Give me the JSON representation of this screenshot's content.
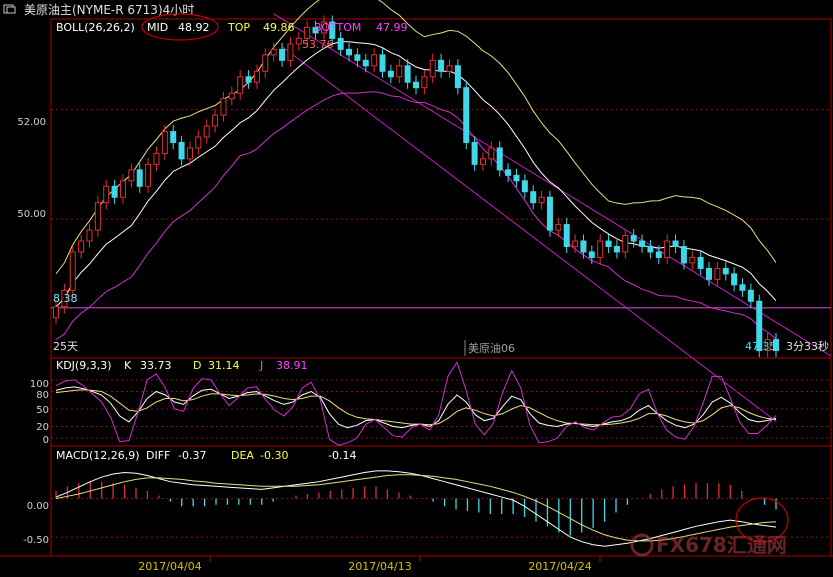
{
  "window": {
    "title": "美原油主(NYME-R 6713)4小时",
    "icon": "window-menu-icon"
  },
  "colors": {
    "background": "#000000",
    "frame": "#b00000",
    "grid_red": "#8a1010",
    "bull_candle": "#e03030",
    "bear_candle": "#40d8e8",
    "boll_mid": "#ffffff",
    "boll_top": "#e8e080",
    "boll_bottom": "#d030d0",
    "channel": "#c020c0",
    "k_line": "#ffffff",
    "d_line": "#e8e080",
    "j_line": "#d030d0",
    "label_white": "#ffffff",
    "label_yellow": "#ffff40",
    "label_magenta": "#ff40ff",
    "annotation": "#c00000",
    "date_label": "#d8c000",
    "price_axis_label": "#ff6060"
  },
  "chart_data": [
    {
      "type": "candlestick",
      "panel": "price",
      "indicator": {
        "name": "BOLL(26,26,2)",
        "mid_label": "MID",
        "mid": "48.92",
        "top_label": "TOP",
        "top": "49.86",
        "bottom_label": "BOTTOM",
        "bottom": "47.99"
      },
      "y_ticks": [
        "52.00",
        "50.00"
      ],
      "ylim": [
        47.5,
        53.6
      ],
      "horizontal_line": {
        "value": 48.38,
        "label": "8.38"
      },
      "annotations": {
        "high": "53.76",
        "last_price": "47.35",
        "countdown": "3分33秒",
        "period_label": "25天",
        "instrument": "美原油06"
      },
      "x_dates": [
        "2017/04/04",
        "2017/04/13",
        "2017/04/24"
      ],
      "ohlc_close": [
        48.4,
        48.7,
        49.4,
        49.6,
        49.8,
        50.3,
        50.6,
        50.4,
        50.7,
        50.9,
        50.6,
        51.0,
        51.2,
        51.6,
        51.4,
        51.1,
        51.3,
        51.5,
        51.7,
        51.9,
        52.2,
        52.3,
        52.6,
        52.5,
        52.7,
        53.0,
        53.1,
        52.9,
        53.2,
        53.3,
        53.5,
        53.4,
        53.6,
        53.3,
        53.1,
        53.0,
        52.9,
        52.8,
        53.0,
        52.7,
        52.6,
        52.8,
        52.5,
        52.4,
        52.6,
        52.9,
        52.7,
        52.8,
        52.4,
        51.4,
        51.0,
        51.1,
        51.3,
        50.9,
        50.8,
        50.7,
        50.5,
        50.3,
        50.4,
        49.8,
        49.9,
        49.5,
        49.6,
        49.4,
        49.3,
        49.6,
        49.5,
        49.4,
        49.7,
        49.6,
        49.5,
        49.4,
        49.3,
        49.6,
        49.5,
        49.2,
        49.3,
        49.1,
        48.9,
        49.1,
        49.0,
        48.8,
        48.7,
        48.5,
        47.6,
        47.8,
        47.6
      ]
    },
    {
      "type": "line",
      "panel": "kdj",
      "indicator": {
        "name": "KDJ(9,3,3)",
        "k_label": "K",
        "k": "33.73",
        "d_label": "D",
        "d": "31.14",
        "j_label": "J",
        "j": "38.91"
      },
      "y_ticks": [
        "100",
        "80",
        "50",
        "20",
        "0"
      ],
      "ylim": [
        -10,
        110
      ],
      "series": [
        {
          "name": "K",
          "values": [
            82,
            86,
            88,
            85,
            80,
            74,
            60,
            38,
            28,
            45,
            68,
            80,
            74,
            62,
            58,
            72,
            82,
            84,
            76,
            68,
            72,
            78,
            80,
            72,
            64,
            58,
            62,
            74,
            80,
            70,
            42,
            24,
            18,
            22,
            30,
            32,
            26,
            20,
            18,
            22,
            24,
            20,
            30,
            58,
            74,
            62,
            40,
            30,
            34,
            54,
            72,
            66,
            42,
            26,
            22,
            20,
            24,
            26,
            22,
            20,
            24,
            28,
            30,
            36,
            48,
            56,
            42,
            30,
            22,
            18,
            24,
            40,
            62,
            70,
            60,
            44,
            32,
            28,
            30,
            34
          ]
        },
        {
          "name": "D",
          "values": [
            78,
            80,
            82,
            83,
            82,
            80,
            72,
            60,
            48,
            46,
            52,
            62,
            68,
            68,
            64,
            66,
            72,
            76,
            76,
            74,
            73,
            74,
            76,
            75,
            72,
            68,
            66,
            68,
            72,
            72,
            64,
            52,
            42,
            36,
            33,
            32,
            30,
            28,
            26,
            24,
            24,
            23,
            25,
            34,
            46,
            52,
            48,
            42,
            38,
            42,
            50,
            56,
            52,
            44,
            36,
            30,
            26,
            25,
            24,
            23,
            23,
            24,
            26,
            29,
            34,
            42,
            42,
            38,
            32,
            28,
            26,
            30,
            40,
            52,
            56,
            52,
            44,
            38,
            34,
            32
          ]
        },
        {
          "name": "J",
          "values": [
            90,
            98,
            100,
            90,
            76,
            62,
            36,
            -6,
            -4,
            44,
            100,
            110,
            86,
            50,
            46,
            84,
            102,
            100,
            76,
            56,
            70,
            86,
            88,
            66,
            48,
            38,
            54,
            86,
            96,
            66,
            -2,
            -12,
            -8,
            0,
            24,
            32,
            18,
            4,
            2,
            18,
            24,
            14,
            40,
            106,
            130,
            82,
            24,
            6,
            26,
            78,
            116,
            86,
            22,
            -8,
            -6,
            0,
            20,
            28,
            18,
            14,
            26,
            36,
            38,
            50,
            76,
            84,
            42,
            14,
            2,
            -2,
            20,
            60,
            106,
            106,
            68,
            28,
            8,
            8,
            22,
            39
          ]
        }
      ]
    },
    {
      "type": "bar+line",
      "panel": "macd",
      "indicator": {
        "name": "MACD(12,26,9)",
        "diff_label": "DIFF",
        "diff": "-0.37",
        "dea_label": "DEA",
        "dea": "-0.30",
        "macd": "-0.14"
      },
      "y_ticks": [
        "0.00",
        "-0.50"
      ],
      "ylim": [
        -0.72,
        0.45
      ],
      "series": [
        {
          "name": "DIFF",
          "values": [
            0.02,
            0.08,
            0.15,
            0.22,
            0.28,
            0.32,
            0.34,
            0.33,
            0.3,
            0.26,
            0.22,
            0.2,
            0.18,
            0.17,
            0.16,
            0.15,
            0.14,
            0.13,
            0.12,
            0.14,
            0.16,
            0.18,
            0.2,
            0.22,
            0.25,
            0.28,
            0.31,
            0.34,
            0.36,
            0.36,
            0.35,
            0.33,
            0.3,
            0.26,
            0.22,
            0.18,
            0.14,
            0.1,
            0.06,
            0.02,
            -0.02,
            -0.1,
            -0.2,
            -0.3,
            -0.4,
            -0.5,
            -0.56,
            -0.6,
            -0.62,
            -0.6,
            -0.58,
            -0.55,
            -0.52,
            -0.48,
            -0.44,
            -0.4,
            -0.36,
            -0.33,
            -0.3,
            -0.28,
            -0.3,
            -0.33,
            -0.35,
            -0.37
          ]
        },
        {
          "name": "DEA",
          "values": [
            0.0,
            0.03,
            0.06,
            0.1,
            0.14,
            0.18,
            0.22,
            0.25,
            0.27,
            0.27,
            0.26,
            0.25,
            0.23,
            0.22,
            0.2,
            0.19,
            0.18,
            0.17,
            0.16,
            0.16,
            0.16,
            0.16,
            0.17,
            0.18,
            0.2,
            0.22,
            0.24,
            0.26,
            0.28,
            0.3,
            0.31,
            0.31,
            0.3,
            0.29,
            0.27,
            0.25,
            0.22,
            0.19,
            0.16,
            0.12,
            0.08,
            0.03,
            -0.03,
            -0.1,
            -0.18,
            -0.26,
            -0.34,
            -0.41,
            -0.47,
            -0.51,
            -0.54,
            -0.55,
            -0.55,
            -0.54,
            -0.52,
            -0.49,
            -0.46,
            -0.43,
            -0.4,
            -0.37,
            -0.35,
            -0.33,
            -0.31,
            -0.3
          ]
        },
        {
          "name": "MACD",
          "values": [
            0.1,
            0.16,
            0.2,
            0.22,
            0.22,
            0.2,
            0.18,
            0.14,
            0.1,
            0.04,
            -0.04,
            -0.1,
            -0.1,
            -0.1,
            -0.08,
            -0.08,
            -0.08,
            -0.08,
            -0.08,
            -0.04,
            0.0,
            0.04,
            0.06,
            0.08,
            0.1,
            0.12,
            0.14,
            0.16,
            0.16,
            0.12,
            0.08,
            0.04,
            0.0,
            -0.04,
            -0.1,
            -0.14,
            -0.16,
            -0.18,
            -0.2,
            -0.2,
            -0.2,
            -0.24,
            -0.3,
            -0.36,
            -0.44,
            -0.48,
            -0.44,
            -0.38,
            -0.3,
            -0.18,
            -0.08,
            0.0,
            0.06,
            0.12,
            0.16,
            0.18,
            0.2,
            0.2,
            0.2,
            0.18,
            0.1,
            0.0,
            -0.08,
            -0.14
          ]
        }
      ]
    }
  ],
  "watermark": {
    "text": "FX678汇通网"
  }
}
